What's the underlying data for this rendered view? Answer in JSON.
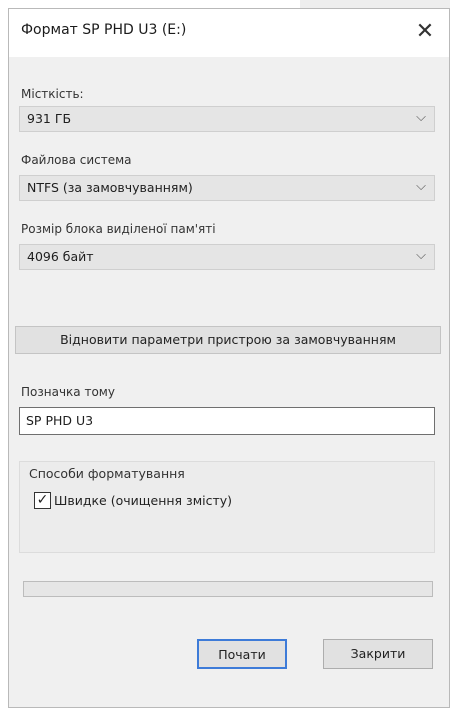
{
  "dialog": {
    "title": "Формат SP PHD U3 (E:)",
    "close_glyph": "✕"
  },
  "capacity": {
    "label": "Місткість:",
    "value": "931 ГБ"
  },
  "filesystem": {
    "label": "Файлова система",
    "value": "NTFS (за замовчуванням)"
  },
  "allocation": {
    "label": "Розмір блока виділеної пам'яті",
    "value": "4096 байт"
  },
  "restore_defaults": {
    "label": "Відновити параметри пристрою за замовчуванням"
  },
  "volume": {
    "label": "Позначка тому",
    "value": "SP PHD U3"
  },
  "format_options": {
    "label": "Способи форматування",
    "quick_format_label": "Швидке (очищення змісту)",
    "quick_format_checked": true
  },
  "progress": {
    "percent": 0
  },
  "buttons": {
    "start": "Почати",
    "close": "Закрити"
  },
  "icons": {
    "chevron": "chevron-down-icon",
    "close": "close-icon",
    "check": "checkmark-icon"
  }
}
